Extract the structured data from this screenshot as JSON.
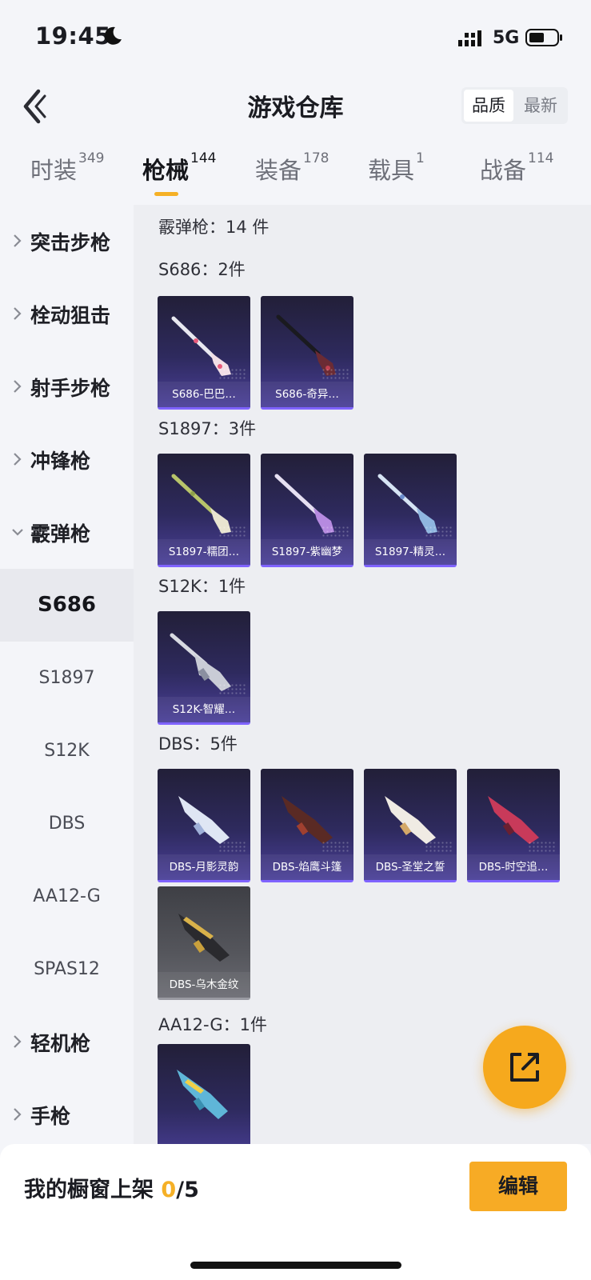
{
  "status_bar": {
    "time": "19:45",
    "network": "5G"
  },
  "header": {
    "title": "游戏仓库",
    "sort_options": [
      "品质",
      "最新"
    ]
  },
  "tabs": [
    {
      "label": "时装",
      "count": "349"
    },
    {
      "label": "枪械",
      "count": "144"
    },
    {
      "label": "装备",
      "count": "178"
    },
    {
      "label": "载具",
      "count": "1"
    },
    {
      "label": "战备",
      "count": "114"
    }
  ],
  "sidebar": {
    "categories_top": [
      "突击步枪",
      "栓动狙击",
      "射手步枪",
      "冲锋枪",
      "霰弹枪"
    ],
    "subcategories": [
      "S686",
      "S1897",
      "S12K",
      "DBS",
      "AA12-G",
      "SPAS12"
    ],
    "categories_bottom": [
      "轻机枪",
      "手枪"
    ]
  },
  "main": {
    "category_summary": "霰弹枪：14 件",
    "sections": [
      {
        "title": "S686：2件",
        "items": [
          "S686-巴巴…",
          "S686-奇异…"
        ]
      },
      {
        "title": "S1897：3件",
        "items": [
          "S1897-糯团…",
          "S1897-紫幽梦",
          "S1897-精灵…"
        ]
      },
      {
        "title": "S12K：1件",
        "items": [
          "S12K-智耀…"
        ]
      },
      {
        "title": "DBS：5件",
        "items": [
          "DBS-月影灵韵",
          "DBS-焰鹰斗篷",
          "DBS-圣堂之誓",
          "DBS-时空追…",
          "DBS-乌木金纹"
        ]
      },
      {
        "title": "AA12-G：1件",
        "items": [
          ""
        ]
      }
    ]
  },
  "bottom_bar": {
    "shelf_label": "我的橱窗上架 ",
    "shelf_count": "0",
    "shelf_total": "/5",
    "edit_label": "编辑"
  },
  "colors": {
    "accent": "#f5b026",
    "card_purple": "#4a3f98",
    "card_grey": "#55565c"
  },
  "icons": [
    "back-arrow-icon",
    "moon-icon",
    "signal-icon",
    "battery-icon",
    "chevron-right-icon",
    "chevron-down-icon",
    "share-external-icon"
  ]
}
